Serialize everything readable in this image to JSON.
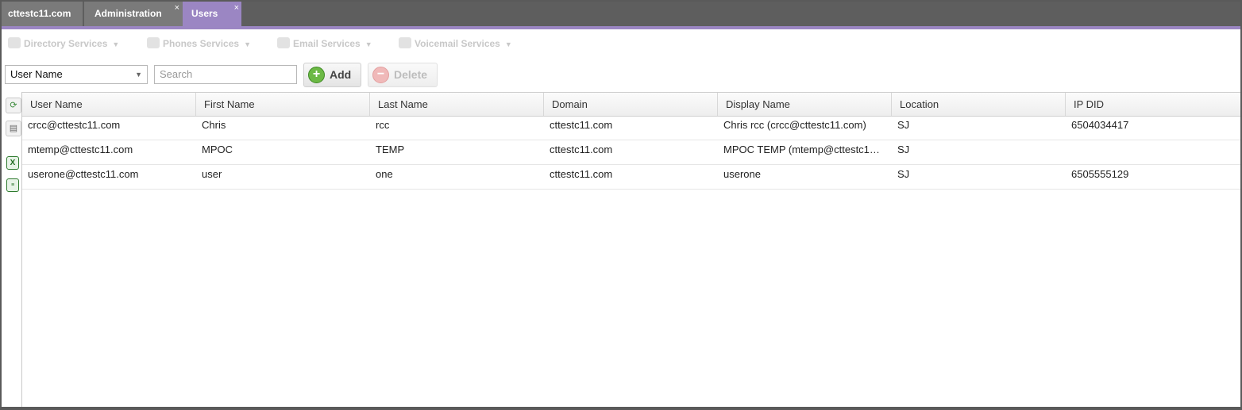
{
  "tabs": [
    {
      "label": "cttestc11.com"
    },
    {
      "label": "Administration",
      "close": "×"
    },
    {
      "label": "Users",
      "close": "×"
    }
  ],
  "services": [
    {
      "label": "Directory Services",
      "icon": "directory-icon"
    },
    {
      "label": "Phones Services",
      "icon": "phone-icon"
    },
    {
      "label": "Email Services",
      "icon": "email-icon"
    },
    {
      "label": "Voicemail Services",
      "icon": "voicemail-icon"
    }
  ],
  "toolbar": {
    "filter_value": "User Name",
    "search_placeholder": "Search",
    "add_label": "Add",
    "delete_label": "Delete"
  },
  "table": {
    "columns": [
      "User Name",
      "First Name",
      "Last Name",
      "Domain",
      "Display Name",
      "Location",
      "IP DID"
    ],
    "rows": [
      [
        "crcc@cttestc11.com",
        "Chris",
        "rcc",
        "cttestc11.com",
        "Chris rcc (crcc@cttestc11.com)",
        "SJ",
        "6504034417"
      ],
      [
        "mtemp@cttestc11.com",
        "MPOC",
        "TEMP",
        "cttestc11.com",
        "MPOC TEMP (mtemp@cttestc1…",
        "SJ",
        ""
      ],
      [
        "userone@cttestc11.com",
        "user",
        "one",
        "cttestc11.com",
        "userone",
        "SJ",
        "6505555129"
      ]
    ]
  },
  "colors": {
    "accent": "#9b86c3",
    "tabbar": "#5e5e5e",
    "add_green": "#6cb945"
  }
}
